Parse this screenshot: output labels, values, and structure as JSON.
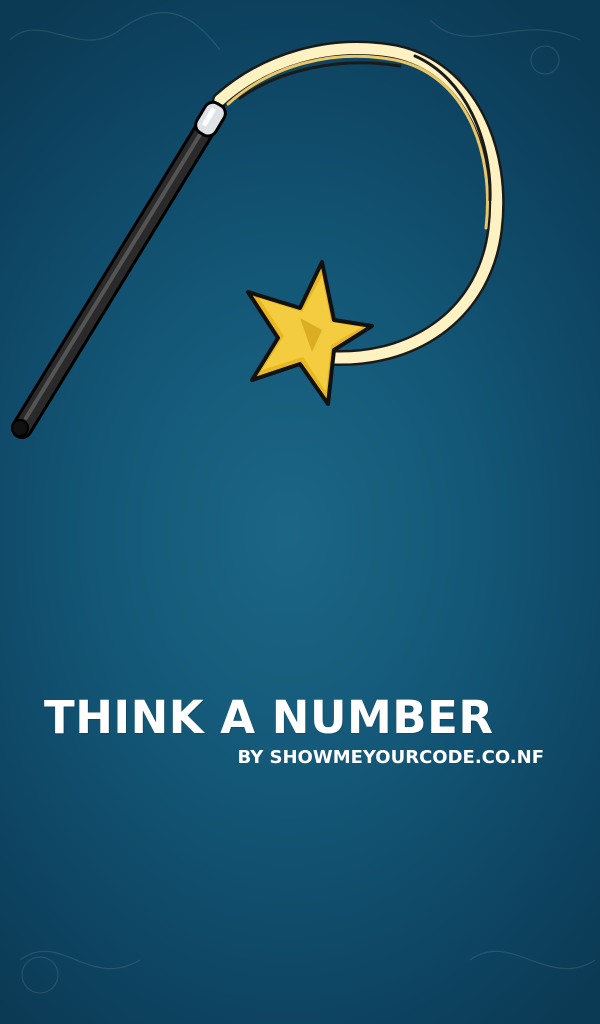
{
  "splash": {
    "title": "THINK A NUMBER",
    "subtitle": "BY SHOWMEYOURCODE.CO.NF"
  },
  "colors": {
    "background": "#145878",
    "title_text": "#ffffff",
    "star": "#e8b721",
    "trail": "#fde9a8",
    "wand": "#1e1e1e"
  },
  "icons": [
    "magic-wand-icon",
    "star-icon",
    "sparkle-trail-icon"
  ]
}
